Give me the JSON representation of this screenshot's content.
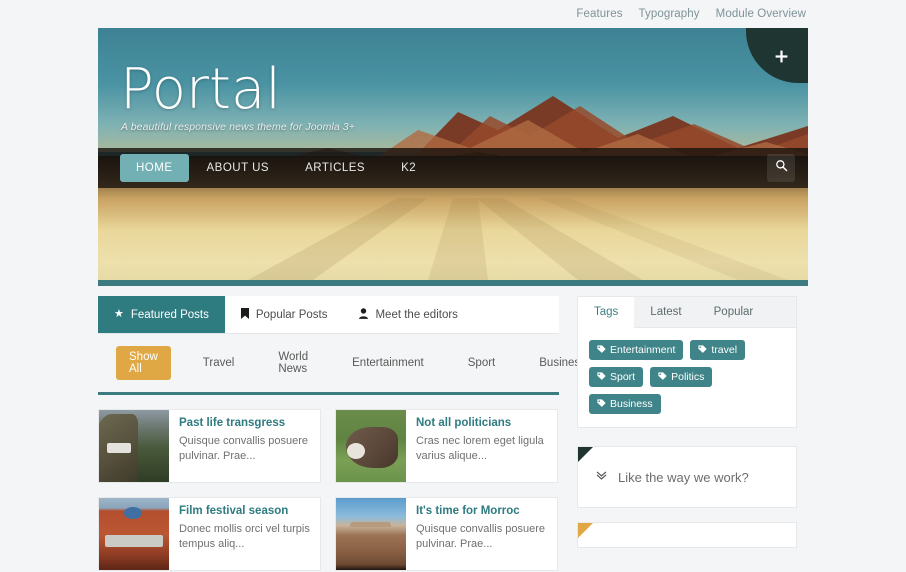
{
  "topbar": {
    "links": [
      {
        "label": "Features"
      },
      {
        "label": "Typography"
      },
      {
        "label": "Module Overview"
      }
    ]
  },
  "hero": {
    "title": "Portal",
    "tagline": "A beautiful responsive news theme for Joomla 3+",
    "plus_icon": "plus-icon",
    "plus_glyph": "✛"
  },
  "nav": {
    "items": [
      {
        "label": "HOME",
        "active": true
      },
      {
        "label": "ABOUT US",
        "active": false
      },
      {
        "label": "ARTICLES",
        "active": false
      },
      {
        "label": "K2",
        "active": false
      }
    ],
    "search_icon": "search-icon"
  },
  "content_tabs": [
    {
      "label": "Featured Posts",
      "icon": "star-icon",
      "glyph": "★",
      "active": true
    },
    {
      "label": "Popular Posts",
      "icon": "bookmark-icon",
      "glyph": "🔖",
      "active": false
    },
    {
      "label": "Meet the editors",
      "icon": "user-icon",
      "glyph": "👤",
      "active": false
    }
  ],
  "filters": [
    {
      "label": "Show All",
      "active": true
    },
    {
      "label": "Travel",
      "active": false
    },
    {
      "label": "World News",
      "active": false
    },
    {
      "label": "Entertainment",
      "active": false
    },
    {
      "label": "Sport",
      "active": false
    },
    {
      "label": "Business",
      "active": false
    }
  ],
  "articles": [
    {
      "title": "Past life transgress",
      "excerpt": "Quisque convallis posuere pulvinar. Prae...",
      "thumb": "cliff-monastery-photo"
    },
    {
      "title": "Not all politicians",
      "excerpt": "Cras nec lorem eget ligula varius alique...",
      "thumb": "donkey-photo"
    },
    {
      "title": "Film festival season",
      "excerpt": "Donec mollis orci vel turpis tempus aliq...",
      "thumb": "theater-building-photo"
    },
    {
      "title": "It's time for Morroc",
      "excerpt": "Quisque convallis posuere pulvinar. Prae...",
      "thumb": "desert-road-photo"
    }
  ],
  "sidebar": {
    "tabs": [
      {
        "label": "Tags",
        "active": true
      },
      {
        "label": "Latest",
        "active": false
      },
      {
        "label": "Popular",
        "active": false
      }
    ],
    "tags": [
      {
        "label": "Entertainment"
      },
      {
        "label": "travel"
      },
      {
        "label": "Sport"
      },
      {
        "label": "Politics"
      },
      {
        "label": "Business"
      }
    ],
    "tag_icon": "tag-icon",
    "tag_glyph": "🏷",
    "modules": [
      {
        "title": "Like the way we work?",
        "ribbon": "dark",
        "chevron": "chevron-down-icon",
        "chevron_glyph": "⌄"
      },
      {
        "title": "",
        "ribbon": "gold",
        "chevron": "",
        "chevron_glyph": ""
      }
    ]
  },
  "colors": {
    "teal": "#2e7b80",
    "teal_light": "#73b0b4",
    "gold": "#dfa844",
    "dark": "#1e3531",
    "page_bg": "#f4f5f6"
  }
}
